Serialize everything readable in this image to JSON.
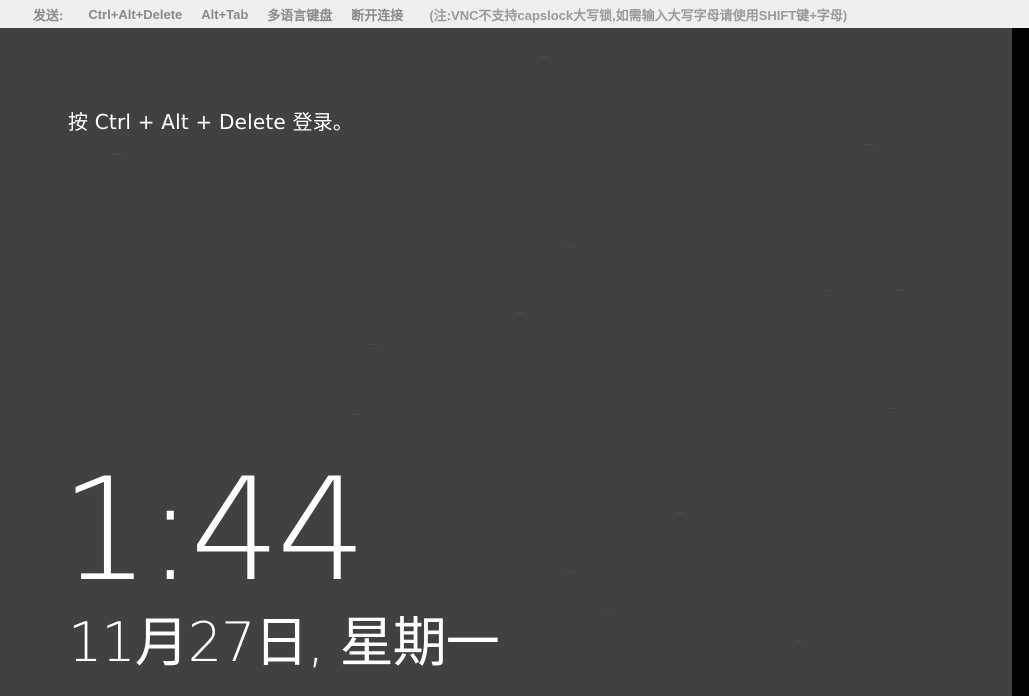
{
  "toolbar": {
    "send_label": "发送:",
    "buttons": [
      {
        "label": "Ctrl+Alt+Delete"
      },
      {
        "label": "Alt+Tab"
      },
      {
        "label": "多语言键盘"
      },
      {
        "label": "断开连接"
      }
    ],
    "note": "(注:VNC不支持capslock大写锁,如需输入大写字母请使用SHIFT键+字母)"
  },
  "lock_screen": {
    "prompt": "按 Ctrl + Alt + Delete 登录。",
    "time": "1:44",
    "date": "11月27日, 星期一"
  },
  "colors": {
    "toolbar_bg": "#efefef",
    "toolbar_text": "#8a8a8a",
    "screen_bg": "#414141",
    "text": "#ffffff"
  }
}
